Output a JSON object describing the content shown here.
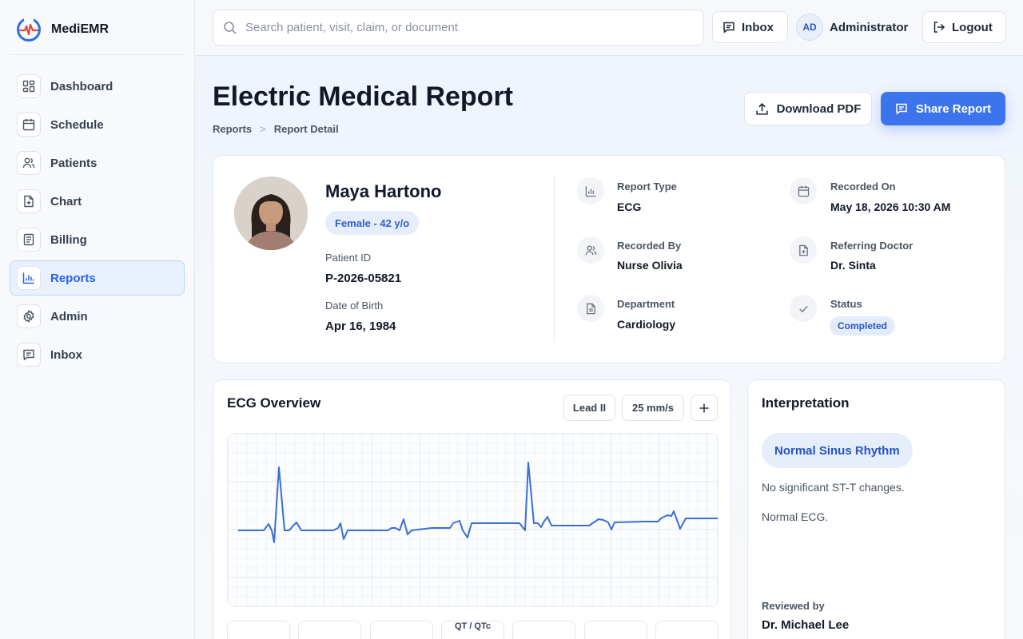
{
  "app": {
    "name": "MediEMR"
  },
  "sidebar": {
    "items": [
      {
        "label": "Dashboard",
        "icon": "grid-icon",
        "active": false
      },
      {
        "label": "Schedule",
        "icon": "calendar-icon",
        "active": false
      },
      {
        "label": "Patients",
        "icon": "users-icon",
        "active": false
      },
      {
        "label": "Chart",
        "icon": "file-plus-icon",
        "active": false
      },
      {
        "label": "Billing",
        "icon": "receipt-icon",
        "active": false
      },
      {
        "label": "Reports",
        "icon": "bar-chart-icon",
        "active": true
      },
      {
        "label": "Admin",
        "icon": "gear-icon",
        "active": false
      },
      {
        "label": "Inbox",
        "icon": "message-icon",
        "active": false
      }
    ]
  },
  "topbar": {
    "search_placeholder": "Search patient, visit, claim, or document",
    "inbox_label": "Inbox",
    "user_initials": "AD",
    "user_name": "Administrator",
    "logout_label": "Logout"
  },
  "page": {
    "title": "Electric Medical Report",
    "breadcrumb": [
      "Reports",
      "Report Detail"
    ],
    "breadcrumb_separator": ">",
    "download_label": "Download PDF",
    "share_label": "Share Report"
  },
  "patient": {
    "name": "Maya Hartono",
    "badge": "Female - 42 y/o",
    "id_label": "Patient ID",
    "id_value": "P-2026-05821",
    "dob_label": "Date of Birth",
    "dob_value": "Apr 16, 1984"
  },
  "report_meta": {
    "report_type": {
      "label": "Report Type",
      "value": "ECG"
    },
    "recorded_on": {
      "label": "Recorded On",
      "value": "May 18, 2026 10:30 AM"
    },
    "recorded_by": {
      "label": "Recorded By",
      "value": "Nurse Olivia"
    },
    "referring_doctor": {
      "label": "Referring Doctor",
      "value": "Dr. Sinta"
    },
    "department": {
      "label": "Department",
      "value": "Cardiology"
    },
    "status": {
      "label": "Status",
      "value": "Completed"
    }
  },
  "ecg": {
    "title": "ECG Overview",
    "lead": "Lead II",
    "speed": "25 mm/s",
    "metrics": [
      "",
      "",
      "",
      "QT / QTc",
      "",
      "",
      ""
    ]
  },
  "interpretation": {
    "title": "Interpretation",
    "rhythm": "Normal Sinus Rhythm",
    "notes": [
      "No significant ST-T changes.",
      "Normal ECG."
    ],
    "reviewed_label": "Reviewed by",
    "reviewed_by": "Dr. Michael Lee"
  },
  "colors": {
    "accent": "#3b74ec",
    "accent_soft": "#e6eefc",
    "ecg_trace": "#3a6fd8"
  }
}
